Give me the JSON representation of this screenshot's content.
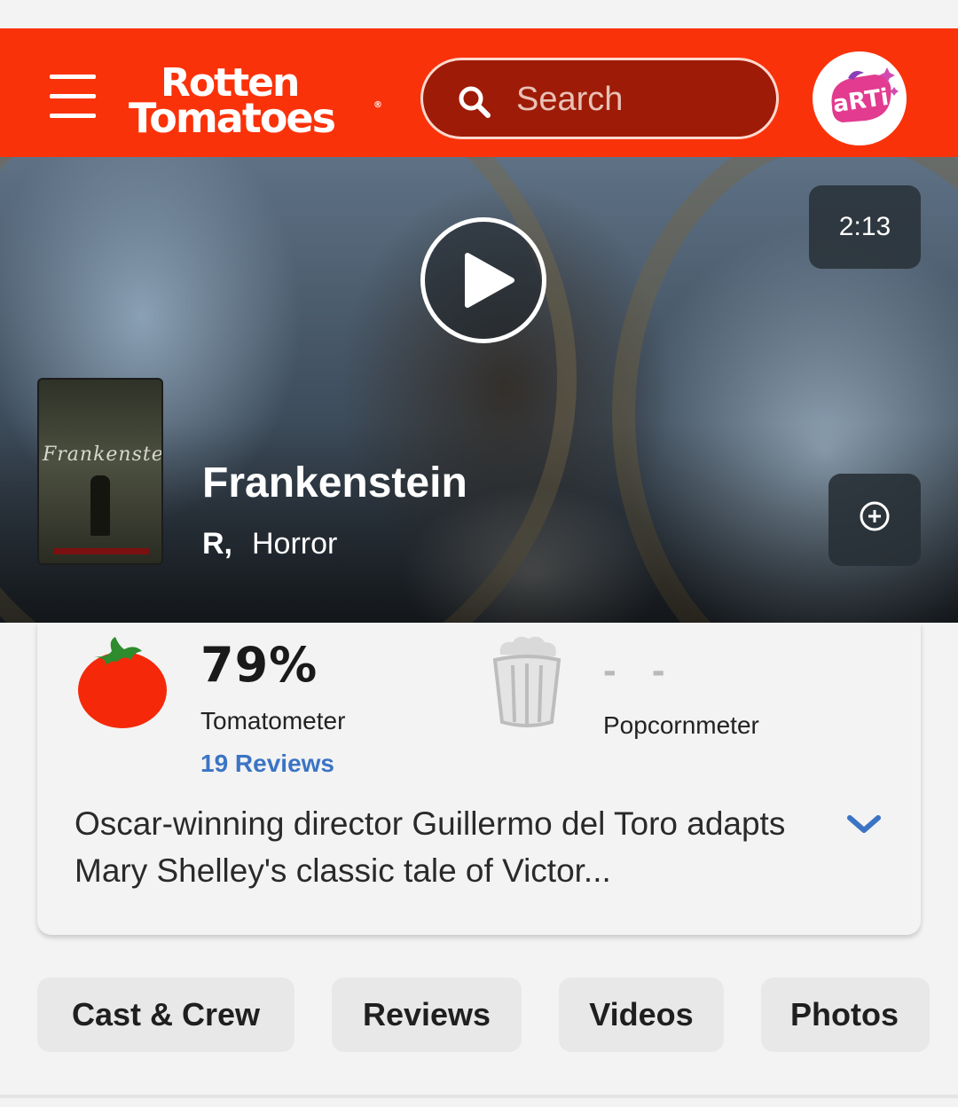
{
  "header": {
    "logo_line1": "Rotten",
    "logo_line2": "Tomatoes",
    "search_placeholder": "Search",
    "avatar_text": "aRTi"
  },
  "hero": {
    "duration": "2:13",
    "title": "Frankenstein",
    "rating": "R,",
    "genre": "Horror",
    "poster_script": "Frankenstein"
  },
  "scores": {
    "tomatometer": "79%",
    "tomatometer_label": "Tomatometer",
    "reviews_link": "19 Reviews",
    "popcornmeter": "- -",
    "popcornmeter_label": "Popcornmeter"
  },
  "synopsis": "Oscar-winning director Guillermo del Toro adapts Mary Shelley's classic tale of Victor...",
  "tabs": [
    {
      "label": "Cast & Crew"
    },
    {
      "label": "Reviews"
    },
    {
      "label": "Videos"
    },
    {
      "label": "Photos"
    }
  ],
  "colors": {
    "brand_red": "#fa320a",
    "search_bg": "#9e1b07",
    "link_blue": "#3b74c4",
    "tomato_red": "#f5290a",
    "tomato_leaf": "#2e8b2e"
  },
  "icons": {
    "menu": "hamburger-icon",
    "search": "search-icon",
    "play": "play-icon",
    "add": "plus-circle-icon",
    "tomato": "fresh-tomato-icon",
    "popcorn": "empty-popcorn-icon",
    "expand": "chevron-down-icon"
  }
}
